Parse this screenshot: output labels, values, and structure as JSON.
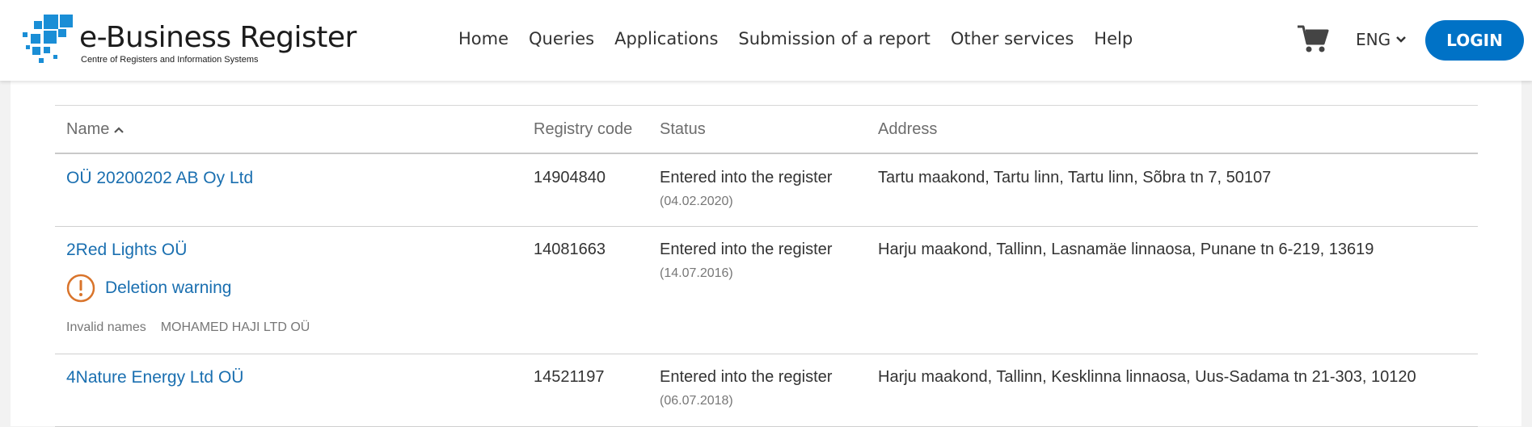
{
  "header": {
    "logo_title": "e-Business Register",
    "logo_subtitle": "Centre of Registers and Information Systems",
    "nav": [
      "Home",
      "Queries",
      "Applications",
      "Submission of a report",
      "Other services",
      "Help"
    ],
    "language": "ENG",
    "login_label": "LOGIN",
    "accent_color": "#0072c6"
  },
  "table": {
    "columns": {
      "name": "Name",
      "registry_code": "Registry code",
      "status": "Status",
      "address": "Address"
    },
    "rows": [
      {
        "name": "OÜ 20200202 AB Oy Ltd",
        "registry_code": "14904840",
        "status": "Entered into the register",
        "status_date": "(04.02.2020)",
        "address": "Tartu maakond, Tartu linn, Tartu linn, Sõbra tn 7, 50107"
      },
      {
        "name": "2Red Lights OÜ",
        "warning": "Deletion warning",
        "invalid_names_label": "Invalid names",
        "invalid_names_value": "MOHAMED HAJI LTD OÜ",
        "registry_code": "14081663",
        "status": "Entered into the register",
        "status_date": "(14.07.2016)",
        "address": "Harju maakond, Tallinn, Lasnamäe linnaosa, Punane tn 6-219, 13619"
      },
      {
        "name": "4Nature Energy Ltd OÜ",
        "registry_code": "14521197",
        "status": "Entered into the register",
        "status_date": "(06.07.2018)",
        "address": "Harju maakond, Tallinn, Kesklinna linnaosa, Uus-Sadama tn 21-303, 10120"
      }
    ]
  }
}
